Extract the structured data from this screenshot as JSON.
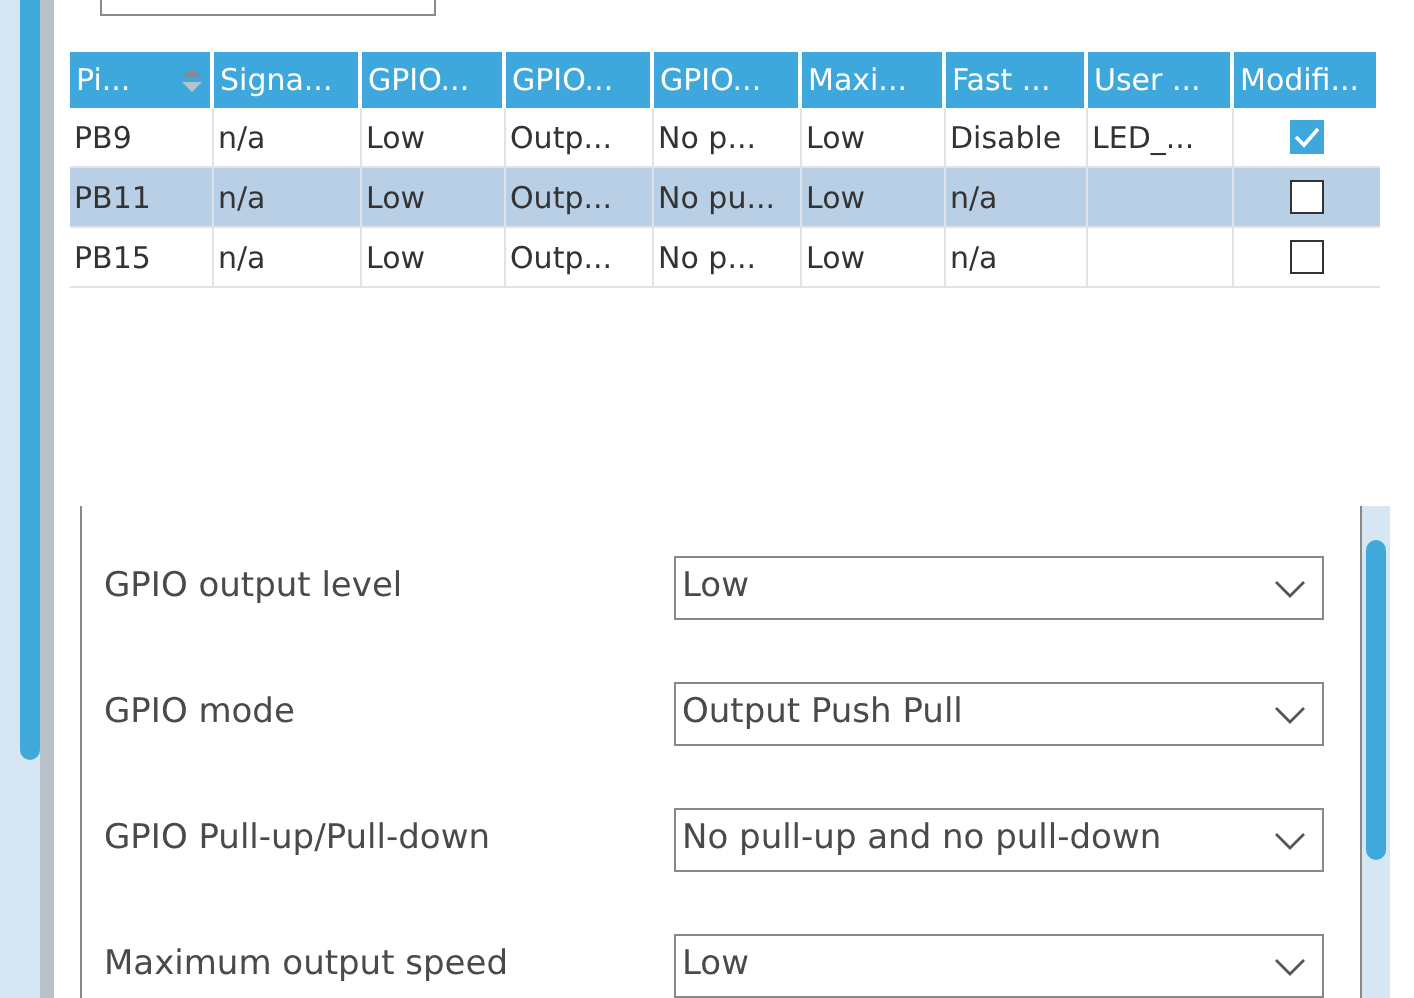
{
  "pin_table": {
    "columns": [
      {
        "label": "Pi...",
        "sorted": true
      },
      {
        "label": "Signa..."
      },
      {
        "label": "GPIO..."
      },
      {
        "label": "GPIO..."
      },
      {
        "label": "GPIO..."
      },
      {
        "label": "Maxi..."
      },
      {
        "label": "Fast ..."
      },
      {
        "label": "User ..."
      },
      {
        "label": "Modifi..."
      }
    ],
    "rows": [
      {
        "selected": false,
        "cells": [
          "PB9",
          "n/a",
          "Low",
          "Outp...",
          "No p...",
          "Low",
          "Disable",
          "LED_..."
        ],
        "modified": true
      },
      {
        "selected": true,
        "cells": [
          "PB11",
          "n/a",
          "Low",
          "Outp...",
          "No pu...",
          "Low",
          "n/a",
          ""
        ],
        "modified": false
      },
      {
        "selected": false,
        "cells": [
          "PB15",
          "n/a",
          "Low",
          "Outp...",
          "No p...",
          "Low",
          "n/a",
          ""
        ],
        "modified": false
      }
    ]
  },
  "settings": [
    {
      "label": "GPIO output level",
      "value": "Low"
    },
    {
      "label": "GPIO mode",
      "value": "Output Push Pull"
    },
    {
      "label": "GPIO Pull-up/Pull-down",
      "value": "No pull-up and no pull-down"
    },
    {
      "label": "Maximum output speed",
      "value": "Low"
    }
  ]
}
